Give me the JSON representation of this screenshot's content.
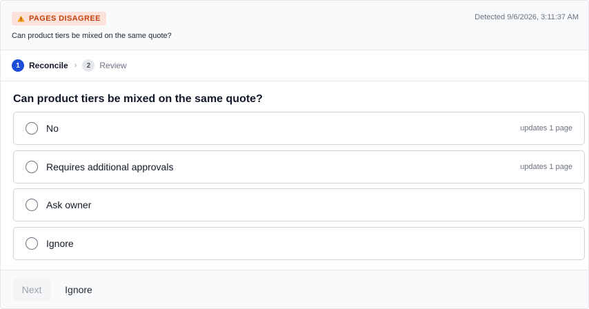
{
  "header": {
    "badge_label": "PAGES DISAGREE",
    "badge_icon": "warning-icon",
    "detected": "Detected 9/6/2026, 3:11:37 AM",
    "question": "Can product tiers be mixed on the same quote?"
  },
  "stepper": {
    "steps": [
      {
        "number": "1",
        "label": "Reconcile",
        "active": true
      },
      {
        "number": "2",
        "label": "Review",
        "active": false
      }
    ]
  },
  "main": {
    "question": "Can product tiers be mixed on the same quote?",
    "options": [
      {
        "label": "No",
        "meta": "updates 1 page"
      },
      {
        "label": "Requires additional approvals",
        "meta": "updates 1 page"
      },
      {
        "label": "Ask owner",
        "meta": ""
      },
      {
        "label": "Ignore",
        "meta": ""
      }
    ]
  },
  "footer": {
    "next_label": "Next",
    "ignore_label": "Ignore"
  },
  "colors": {
    "accent": "#1d4ed8",
    "badge_bg": "#fde2dc",
    "badge_text": "#c2410c",
    "warning_yellow": "#f59e0b"
  }
}
